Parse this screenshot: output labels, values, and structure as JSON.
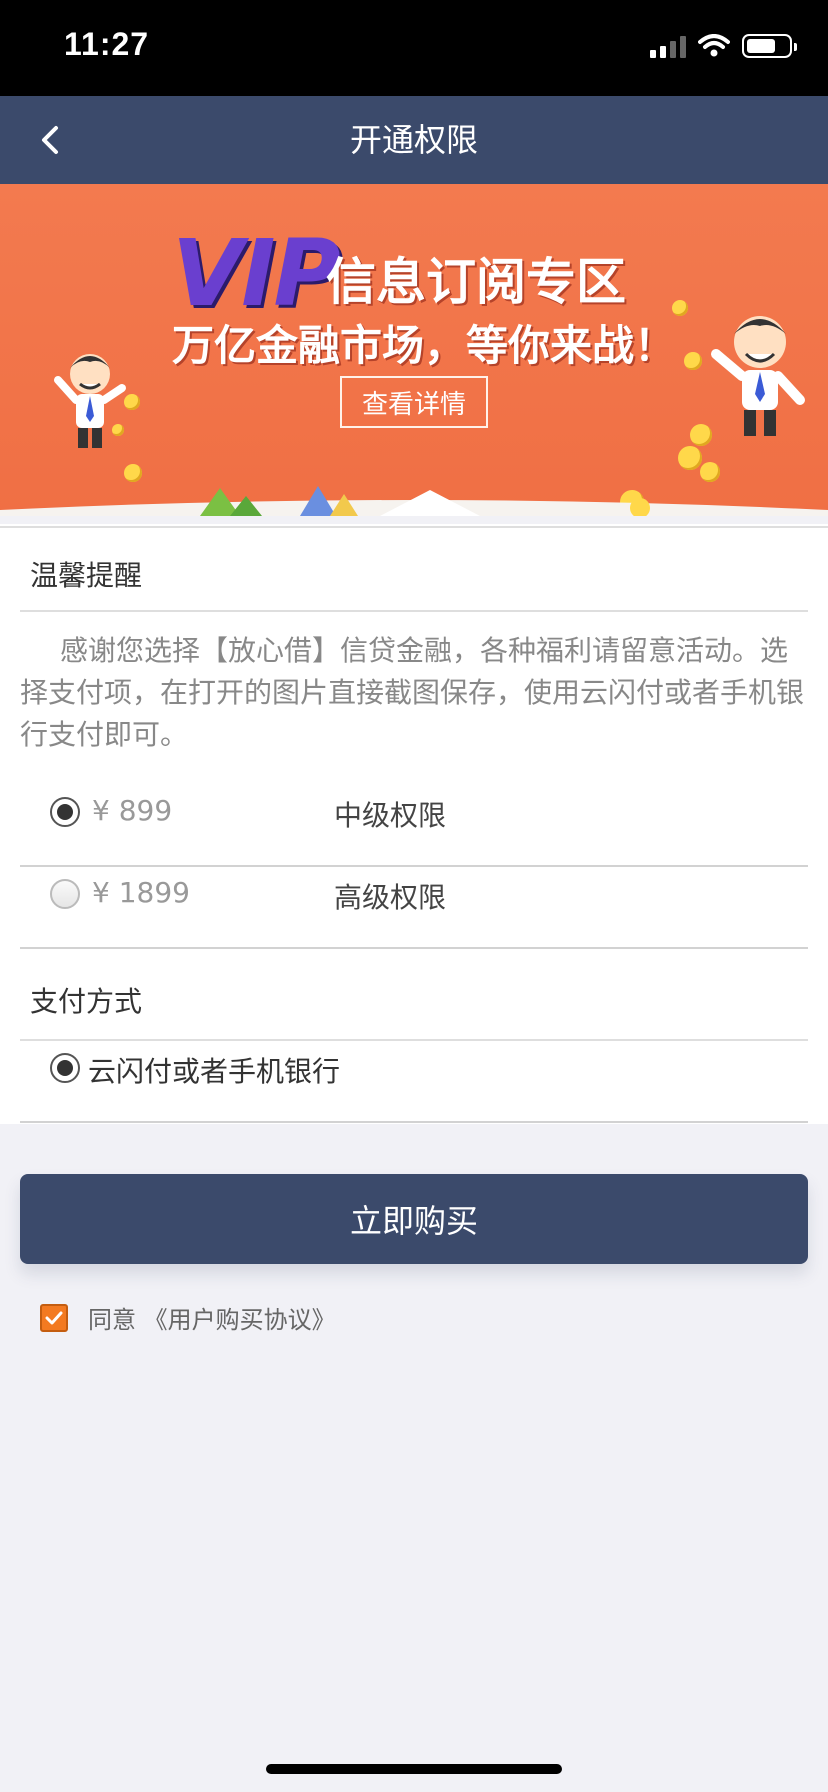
{
  "status_bar": {
    "time": "11:27"
  },
  "nav": {
    "title": "开通权限"
  },
  "banner": {
    "vip": "VIP",
    "line1": "信息订阅专区",
    "line2": "万亿金融市场，等你来战！",
    "detail_button": "查看详情"
  },
  "reminder": {
    "title": "温馨提醒",
    "text": "感谢您选择【放心借】信贷金融，各种福利请留意活动。选择支付项，在打开的图片直接截图保存，使用云闪付或者手机银行支付即可。"
  },
  "plans": [
    {
      "price": "¥ 899",
      "name": "中级权限",
      "selected": true
    },
    {
      "price": "¥ 1899",
      "name": "高级权限",
      "selected": false
    }
  ],
  "payment": {
    "title": "支付方式",
    "method": "云闪付或者手机银行",
    "selected": true
  },
  "buy_button": "立即购买",
  "agreement": {
    "text": "同意 《用户购买协议》",
    "checked": true
  },
  "colors": {
    "primary": "#3b4a6b",
    "banner": "#f37a4f",
    "checkbox": "#f37a21"
  }
}
